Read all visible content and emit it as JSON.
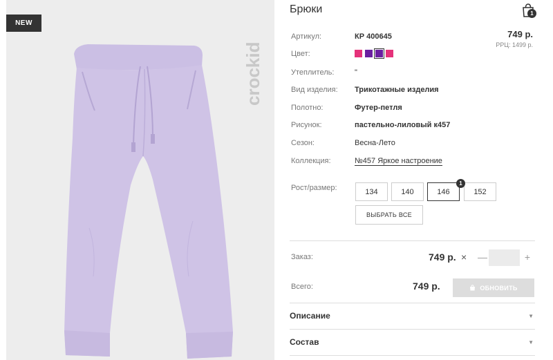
{
  "image": {
    "badge": "NEW",
    "brand": "crockid"
  },
  "product": {
    "title": "Брюки",
    "cart_count": "1",
    "price_top": "749 р.",
    "rrp": "РРЦ: 1499 р.",
    "fields": [
      {
        "label": "Артикул:",
        "value": "КР 400645"
      },
      {
        "label": "Цвет:",
        "value": ""
      },
      {
        "label": "Утеплитель:",
        "value": "\""
      },
      {
        "label": "Вид изделия:",
        "value": "Трикотажные изделия"
      },
      {
        "label": "Полотно:",
        "value": "Футер-петля"
      },
      {
        "label": "Рисунок:",
        "value": "пастельно-лиловый к457"
      },
      {
        "label": "Сезон:",
        "value": "Весна-Лето"
      },
      {
        "label": "Коллекция:",
        "value": "№457 Яркое настроение"
      }
    ],
    "colors": [
      "#e5327a",
      "#6a1fa0",
      "#6a1fa0",
      "#e5327a"
    ],
    "selected_color_index": 2
  },
  "sizes": {
    "label": "Рост/размер:",
    "options": [
      "134",
      "140",
      "146",
      "152"
    ],
    "selected_index": 2,
    "selected_badge": "1",
    "select_all": "ВЫБРАТЬ ВСЕ"
  },
  "order": {
    "label": "Заказ:",
    "price": "749 р.",
    "times": "×",
    "minus": "—",
    "plus": "+",
    "qty": ""
  },
  "total": {
    "label": "Всего:",
    "price": "749 р.",
    "update_button": "ОБНОВИТЬ"
  },
  "sections": [
    {
      "title": "Описание"
    },
    {
      "title": "Состав"
    }
  ],
  "colors": {
    "pants": "#cfc3e6",
    "pants_shade": "#bcaed9",
    "background": "#ededed"
  }
}
